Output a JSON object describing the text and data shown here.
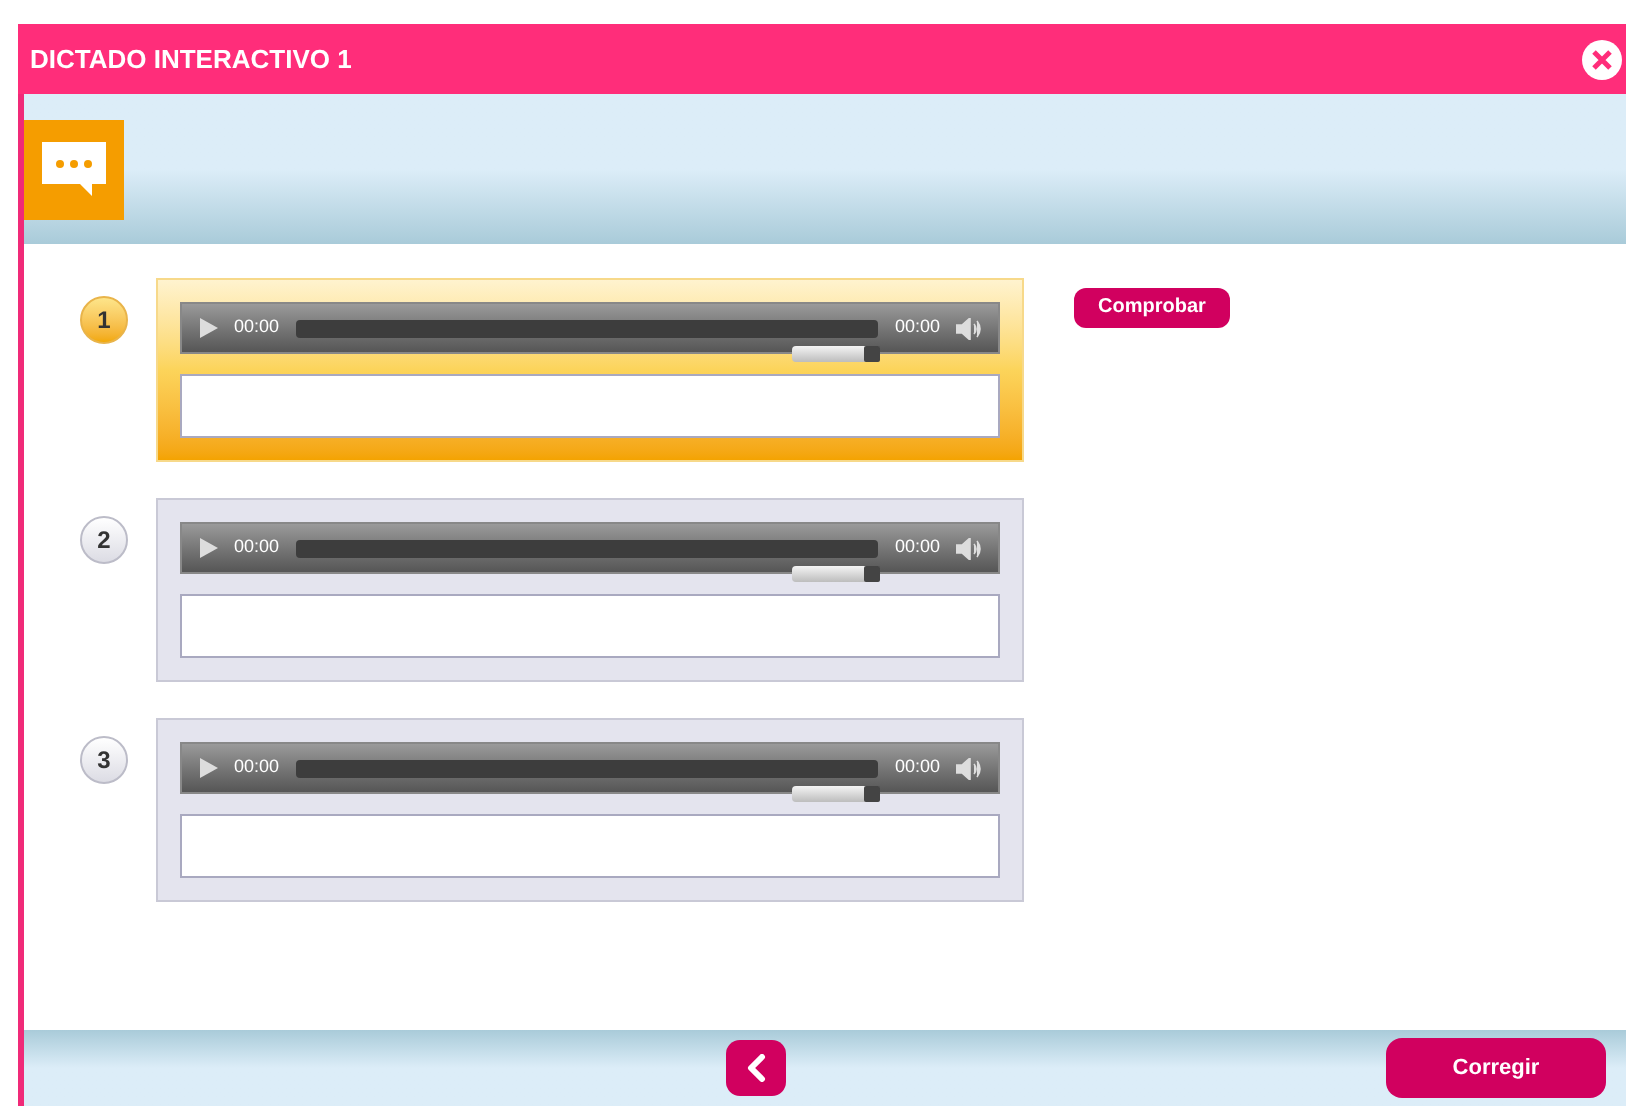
{
  "window": {
    "title": "DICTADO INTERACTIVO 1"
  },
  "items": [
    {
      "number": "1",
      "selected": true,
      "time_elapsed": "00:00",
      "time_total": "00:00",
      "level": 0.9
    },
    {
      "number": "2",
      "selected": false,
      "time_elapsed": "00:00",
      "time_total": "00:00",
      "level": 0.9
    },
    {
      "number": "3",
      "selected": false,
      "time_elapsed": "00:00",
      "time_total": "00:00",
      "level": 0.9
    }
  ],
  "check_button": "Comprobar",
  "footer": {
    "correct_button": "Corregir"
  }
}
